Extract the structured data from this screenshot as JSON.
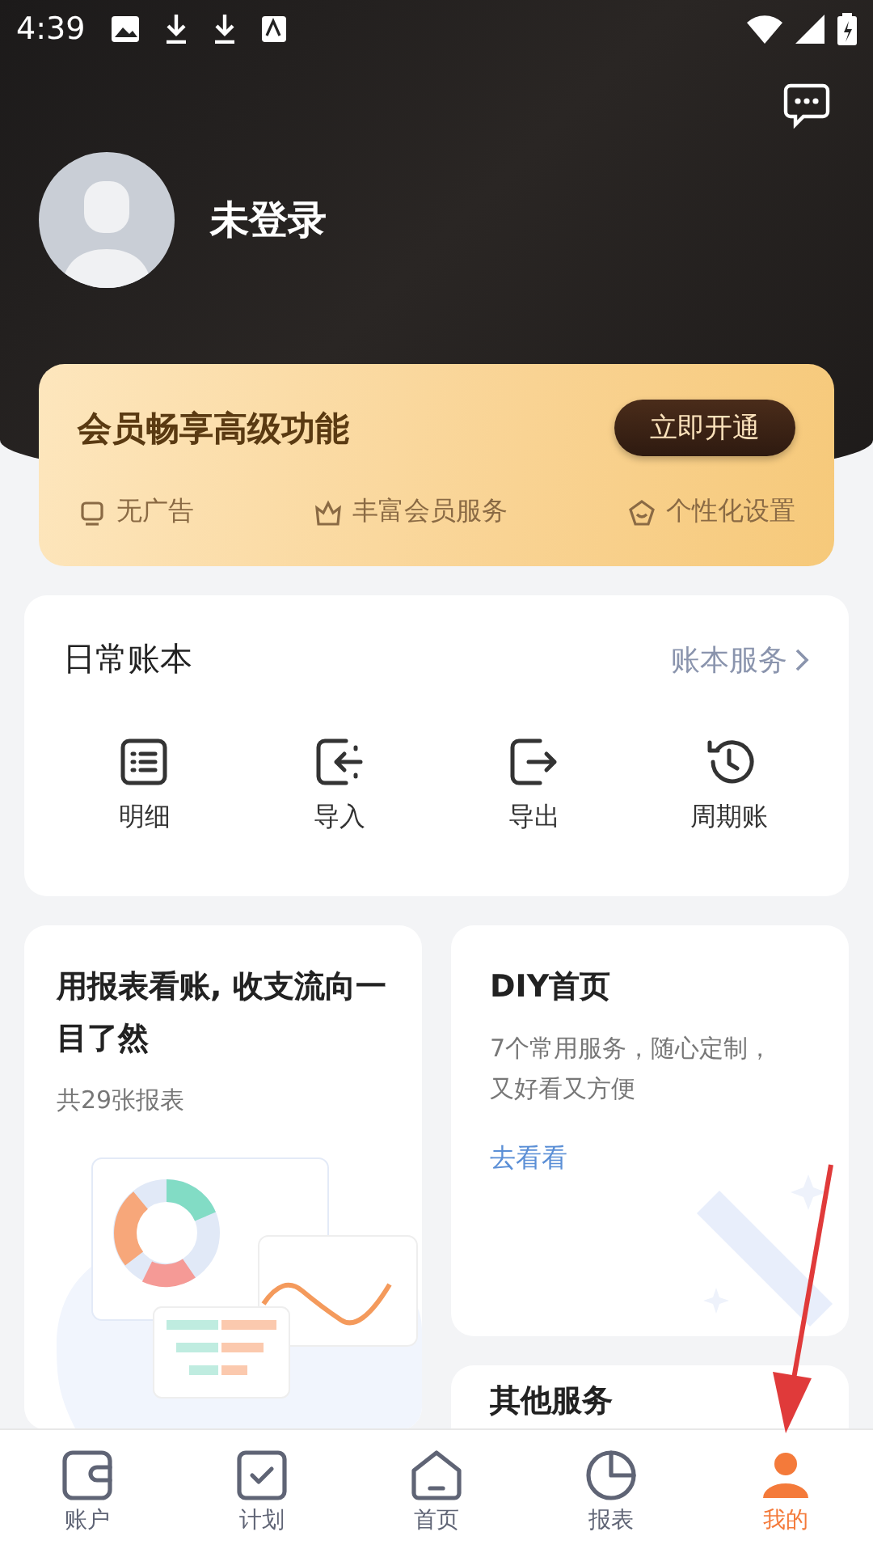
{
  "status_bar": {
    "time": "4:39"
  },
  "profile": {
    "name": "未登录"
  },
  "membership": {
    "title": "会员畅享高级功能",
    "button": "立即开通",
    "perks": [
      {
        "kind": "ad",
        "label": "无广告"
      },
      {
        "kind": "crown",
        "label": "丰富会员服务"
      },
      {
        "kind": "star",
        "label": "个性化设置"
      }
    ]
  },
  "ledger": {
    "title": "日常账本",
    "link": "账本服务",
    "actions": [
      {
        "kind": "list",
        "label": "明细"
      },
      {
        "kind": "import",
        "label": "导入"
      },
      {
        "kind": "export",
        "label": "导出"
      },
      {
        "kind": "cycle",
        "label": "周期账"
      }
    ]
  },
  "report_card": {
    "title": "用报表看账, 收支流向一目了然",
    "subtitle": "共29张报表"
  },
  "diy_card": {
    "title": "DIY首页",
    "description": "7个常用服务，随心定制，又好看又方便",
    "link": "去看看"
  },
  "other_card": {
    "title": "其他服务"
  },
  "tabs": [
    {
      "kind": "wallet",
      "label": "账户",
      "selected": false
    },
    {
      "kind": "plan",
      "label": "计划",
      "selected": false
    },
    {
      "kind": "home",
      "label": "首页",
      "selected": false
    },
    {
      "kind": "report",
      "label": "报表",
      "selected": false
    },
    {
      "kind": "me",
      "label": "我的",
      "selected": true
    }
  ]
}
